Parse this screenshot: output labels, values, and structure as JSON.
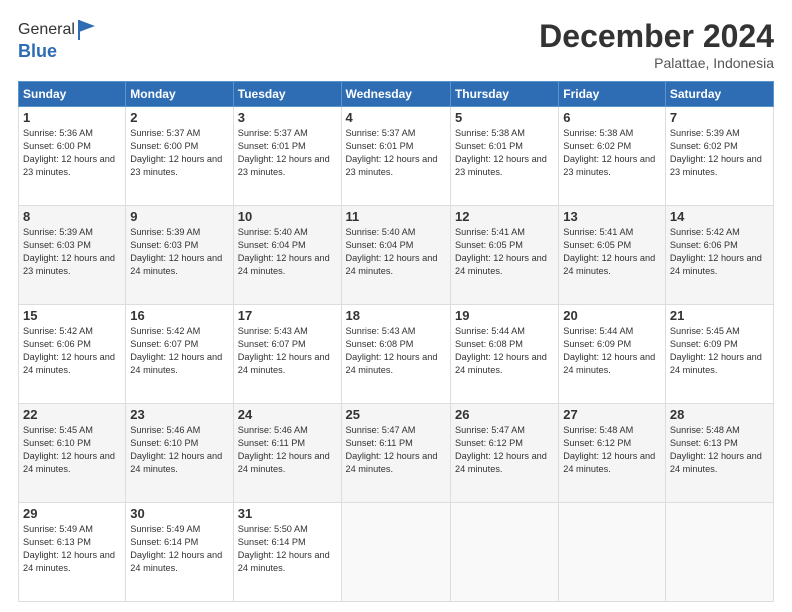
{
  "logo": {
    "general": "General",
    "blue": "Blue"
  },
  "title": "December 2024",
  "location": "Palattae, Indonesia",
  "days_header": [
    "Sunday",
    "Monday",
    "Tuesday",
    "Wednesday",
    "Thursday",
    "Friday",
    "Saturday"
  ],
  "weeks": [
    [
      {
        "day": "1",
        "sunrise": "5:36 AM",
        "sunset": "6:00 PM",
        "daylight": "12 hours and 23 minutes."
      },
      {
        "day": "2",
        "sunrise": "5:37 AM",
        "sunset": "6:00 PM",
        "daylight": "12 hours and 23 minutes."
      },
      {
        "day": "3",
        "sunrise": "5:37 AM",
        "sunset": "6:01 PM",
        "daylight": "12 hours and 23 minutes."
      },
      {
        "day": "4",
        "sunrise": "5:37 AM",
        "sunset": "6:01 PM",
        "daylight": "12 hours and 23 minutes."
      },
      {
        "day": "5",
        "sunrise": "5:38 AM",
        "sunset": "6:01 PM",
        "daylight": "12 hours and 23 minutes."
      },
      {
        "day": "6",
        "sunrise": "5:38 AM",
        "sunset": "6:02 PM",
        "daylight": "12 hours and 23 minutes."
      },
      {
        "day": "7",
        "sunrise": "5:39 AM",
        "sunset": "6:02 PM",
        "daylight": "12 hours and 23 minutes."
      }
    ],
    [
      {
        "day": "8",
        "sunrise": "5:39 AM",
        "sunset": "6:03 PM",
        "daylight": "12 hours and 23 minutes."
      },
      {
        "day": "9",
        "sunrise": "5:39 AM",
        "sunset": "6:03 PM",
        "daylight": "12 hours and 24 minutes."
      },
      {
        "day": "10",
        "sunrise": "5:40 AM",
        "sunset": "6:04 PM",
        "daylight": "12 hours and 24 minutes."
      },
      {
        "day": "11",
        "sunrise": "5:40 AM",
        "sunset": "6:04 PM",
        "daylight": "12 hours and 24 minutes."
      },
      {
        "day": "12",
        "sunrise": "5:41 AM",
        "sunset": "6:05 PM",
        "daylight": "12 hours and 24 minutes."
      },
      {
        "day": "13",
        "sunrise": "5:41 AM",
        "sunset": "6:05 PM",
        "daylight": "12 hours and 24 minutes."
      },
      {
        "day": "14",
        "sunrise": "5:42 AM",
        "sunset": "6:06 PM",
        "daylight": "12 hours and 24 minutes."
      }
    ],
    [
      {
        "day": "15",
        "sunrise": "5:42 AM",
        "sunset": "6:06 PM",
        "daylight": "12 hours and 24 minutes."
      },
      {
        "day": "16",
        "sunrise": "5:42 AM",
        "sunset": "6:07 PM",
        "daylight": "12 hours and 24 minutes."
      },
      {
        "day": "17",
        "sunrise": "5:43 AM",
        "sunset": "6:07 PM",
        "daylight": "12 hours and 24 minutes."
      },
      {
        "day": "18",
        "sunrise": "5:43 AM",
        "sunset": "6:08 PM",
        "daylight": "12 hours and 24 minutes."
      },
      {
        "day": "19",
        "sunrise": "5:44 AM",
        "sunset": "6:08 PM",
        "daylight": "12 hours and 24 minutes."
      },
      {
        "day": "20",
        "sunrise": "5:44 AM",
        "sunset": "6:09 PM",
        "daylight": "12 hours and 24 minutes."
      },
      {
        "day": "21",
        "sunrise": "5:45 AM",
        "sunset": "6:09 PM",
        "daylight": "12 hours and 24 minutes."
      }
    ],
    [
      {
        "day": "22",
        "sunrise": "5:45 AM",
        "sunset": "6:10 PM",
        "daylight": "12 hours and 24 minutes."
      },
      {
        "day": "23",
        "sunrise": "5:46 AM",
        "sunset": "6:10 PM",
        "daylight": "12 hours and 24 minutes."
      },
      {
        "day": "24",
        "sunrise": "5:46 AM",
        "sunset": "6:11 PM",
        "daylight": "12 hours and 24 minutes."
      },
      {
        "day": "25",
        "sunrise": "5:47 AM",
        "sunset": "6:11 PM",
        "daylight": "12 hours and 24 minutes."
      },
      {
        "day": "26",
        "sunrise": "5:47 AM",
        "sunset": "6:12 PM",
        "daylight": "12 hours and 24 minutes."
      },
      {
        "day": "27",
        "sunrise": "5:48 AM",
        "sunset": "6:12 PM",
        "daylight": "12 hours and 24 minutes."
      },
      {
        "day": "28",
        "sunrise": "5:48 AM",
        "sunset": "6:13 PM",
        "daylight": "12 hours and 24 minutes."
      }
    ],
    [
      {
        "day": "29",
        "sunrise": "5:49 AM",
        "sunset": "6:13 PM",
        "daylight": "12 hours and 24 minutes."
      },
      {
        "day": "30",
        "sunrise": "5:49 AM",
        "sunset": "6:14 PM",
        "daylight": "12 hours and 24 minutes."
      },
      {
        "day": "31",
        "sunrise": "5:50 AM",
        "sunset": "6:14 PM",
        "daylight": "12 hours and 24 minutes."
      },
      null,
      null,
      null,
      null
    ]
  ]
}
